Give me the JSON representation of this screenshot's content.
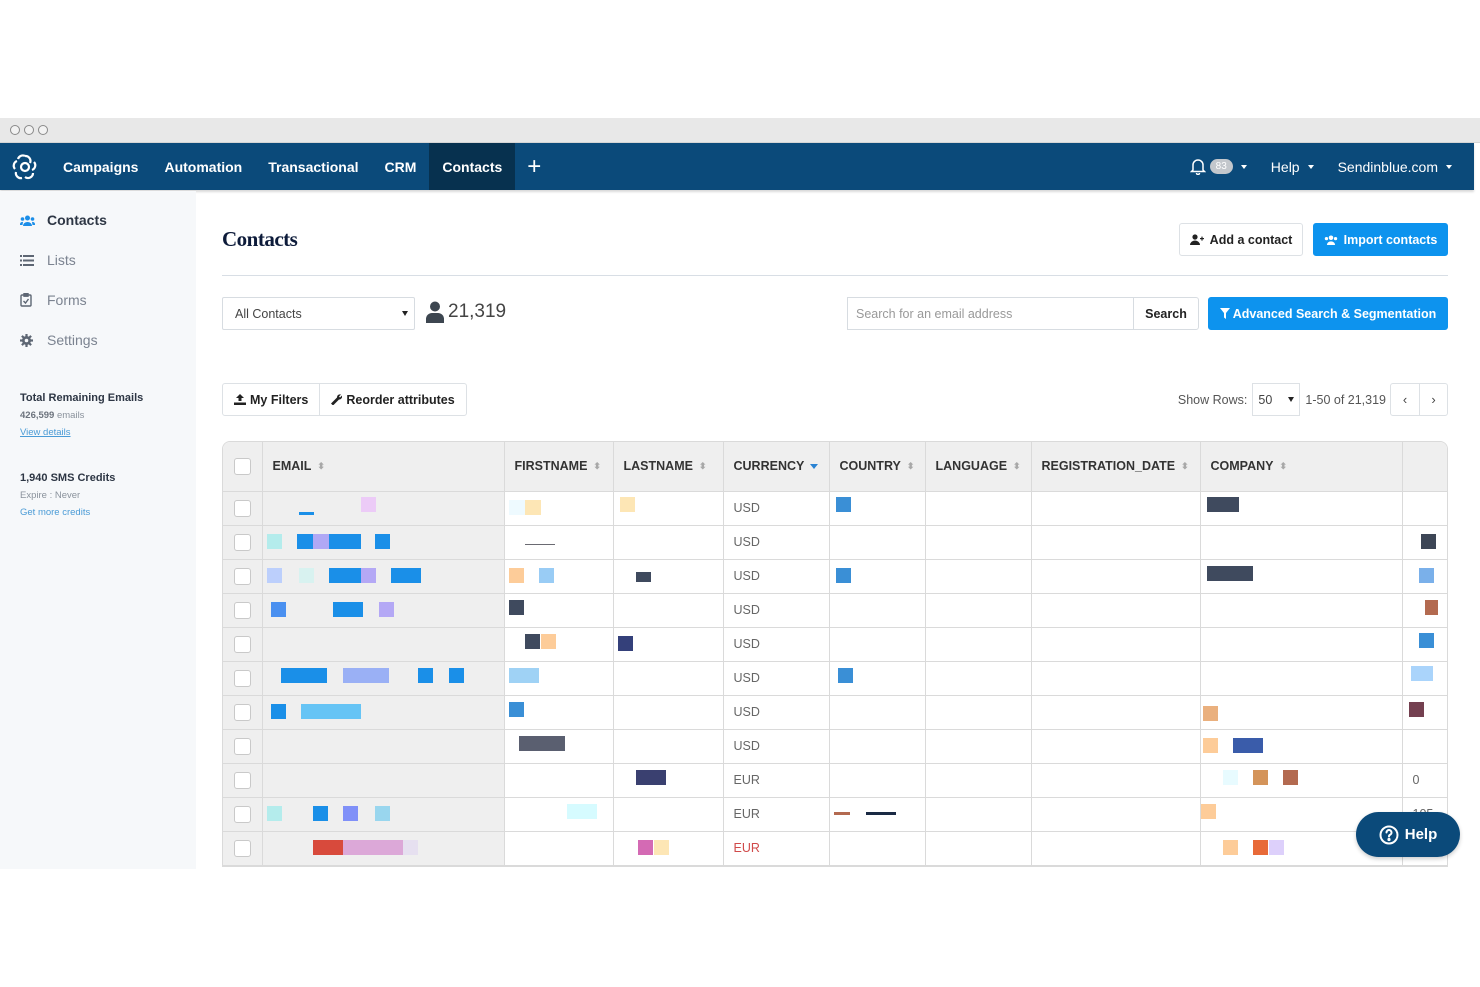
{
  "window": {
    "controls": [
      "close",
      "minimize",
      "maximize"
    ]
  },
  "topnav": {
    "logo": "sendinblue-logo-icon",
    "items": [
      {
        "label": "Campaigns",
        "active": false
      },
      {
        "label": "Automation",
        "active": false
      },
      {
        "label": "Transactional",
        "active": false
      },
      {
        "label": "CRM",
        "active": false
      },
      {
        "label": "Contacts",
        "active": true
      }
    ],
    "add_icon": "+",
    "notifications_count": "83",
    "help_label": "Help",
    "account_label": "Sendinblue.com"
  },
  "sidebar": {
    "items": [
      {
        "label": "Contacts",
        "icon": "users-icon",
        "active": true
      },
      {
        "label": "Lists",
        "icon": "list-icon",
        "active": false
      },
      {
        "label": "Forms",
        "icon": "clipboard-check-icon",
        "active": false
      },
      {
        "label": "Settings",
        "icon": "gear-icon",
        "active": false
      }
    ],
    "emails": {
      "title": "Total Remaining Emails",
      "count": "426,599",
      "unit": "emails",
      "link": "View details"
    },
    "sms": {
      "title": "1,940 SMS Credits",
      "expire": "Expire : Never",
      "link": "Get more credits"
    }
  },
  "main": {
    "title": "Contacts",
    "add_contact_label": "Add a contact",
    "import_contacts_label": "Import contacts",
    "list_select": "All Contacts",
    "contact_count": "21,319",
    "search_placeholder": "Search for an email address",
    "search_label": "Search",
    "advanced_label": "Advanced Search & Segmentation",
    "my_filters_label": "My Filters",
    "reorder_label": "Reorder attributes",
    "show_rows_label": "Show Rows:",
    "rows_value": "50",
    "pagination_text": "1-50 of 21,319",
    "prev_icon": "‹",
    "next_icon": "›"
  },
  "table": {
    "columns": [
      "EMAIL",
      "FIRSTNAME",
      "LASTNAME",
      "CURRENCY",
      "COUNTRY",
      "LANGUAGE",
      "REGISTRATION_DATE",
      "COMPANY",
      ""
    ],
    "sorted_column": "CURRENCY",
    "rows": [
      {
        "currency": "USD",
        "extra": "",
        "currency_highlight": false
      },
      {
        "currency": "USD",
        "extra": "",
        "currency_highlight": false
      },
      {
        "currency": "USD",
        "extra": "",
        "currency_highlight": false
      },
      {
        "currency": "USD",
        "extra": "",
        "currency_highlight": false
      },
      {
        "currency": "USD",
        "extra": "",
        "currency_highlight": false
      },
      {
        "currency": "USD",
        "extra": "",
        "currency_highlight": false
      },
      {
        "currency": "USD",
        "extra": "",
        "currency_highlight": false
      },
      {
        "currency": "USD",
        "extra": "",
        "currency_highlight": false
      },
      {
        "currency": "EUR",
        "extra": "0",
        "currency_highlight": false
      },
      {
        "currency": "EUR",
        "extra": "105",
        "currency_highlight": false
      },
      {
        "currency": "EUR",
        "extra": "",
        "currency_highlight": true
      }
    ],
    "redacted_note": "Cell values in EMAIL, FIRSTNAME, LASTNAME, COUNTRY, COMPANY columns are pixelated/redacted"
  },
  "colors": {
    "nav_bg": "#0b4a7a",
    "nav_active": "#07314f",
    "primary": "#0d93ee",
    "link": "#4a9bd6"
  },
  "help_widget": {
    "label": "Help"
  }
}
